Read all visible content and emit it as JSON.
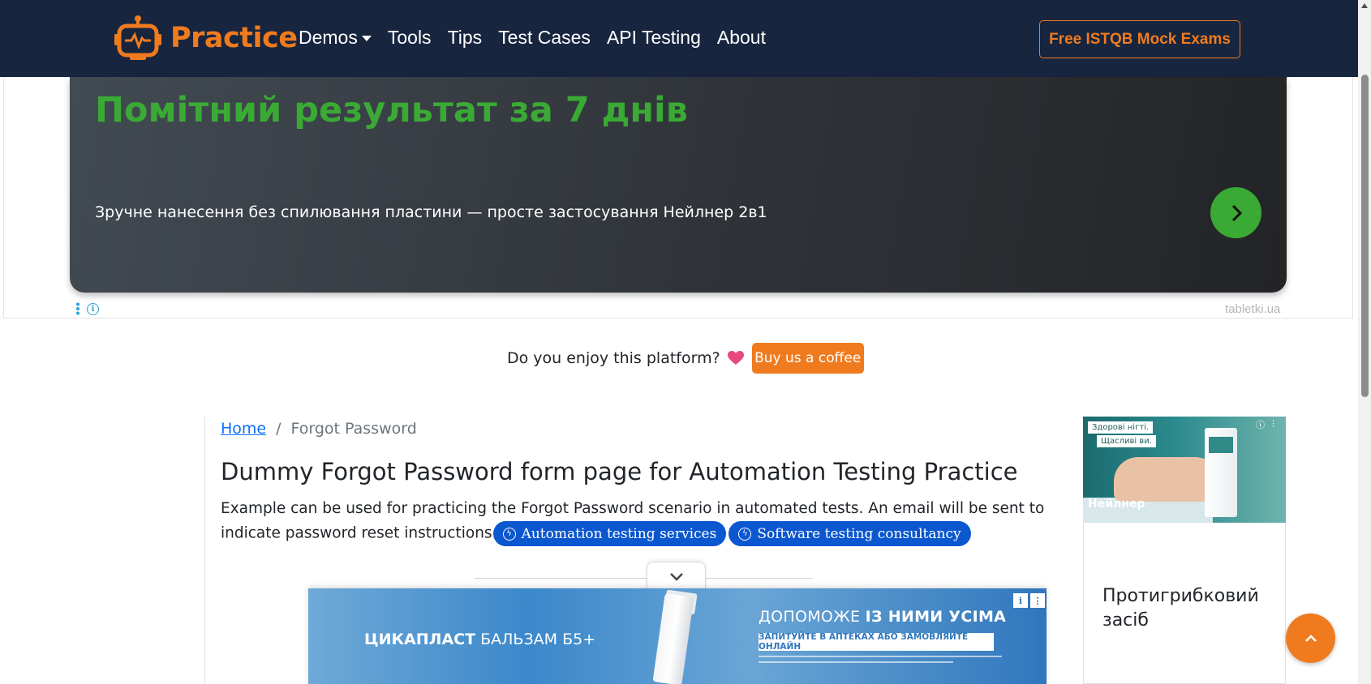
{
  "navbar": {
    "brand": "Practice",
    "links": [
      {
        "label": "Demos",
        "has_dropdown": true
      },
      {
        "label": "Tools"
      },
      {
        "label": "Tips"
      },
      {
        "label": "Test Cases"
      },
      {
        "label": "API Testing"
      },
      {
        "label": "About"
      }
    ],
    "cta": "Free ISTQB Mock Exams",
    "colors": {
      "bg": "#17253f",
      "accent": "#f07b1e"
    }
  },
  "top_ad": {
    "headline": "Помітний результат за 7 днів",
    "subtitle": "Зручне нанесення без спилювання пластини — просте застосування Нейлнер 2в1",
    "source": "tabletki.ua",
    "next_icon": "chevron-right-icon",
    "colors": {
      "headline": "#3aaa35"
    }
  },
  "coffee": {
    "question": "Do you enjoy this platform?",
    "heart_icon": "heart-icon",
    "button": "Buy us a coffee"
  },
  "breadcrumb": {
    "home": "Home",
    "separator": "/",
    "current": "Forgot Password"
  },
  "page": {
    "title": "Dummy Forgot Password form page for Automation Testing Practice",
    "description": "Example can be used for practicing the Forgot Password scenario in automated tests. An email will be sent to indicate password reset instructions",
    "pills": [
      "Automation testing services",
      "Software testing consultancy"
    ]
  },
  "bottom_ad": {
    "brand_bold": "ЦИКАПЛАСТ",
    "brand_rest": " БАЛЬЗАМ Б5+",
    "head_pre": "ДОПОМОЖЕ ",
    "head_bold": "ІЗ НИМИ УСІМА",
    "strip": "ЗАПИТУЙТЕ В АПТЕКАХ АБО ЗАМОВЛЯЙТЕ ОНЛАЙН"
  },
  "side_ad": {
    "tag1": "Здорові нігті.",
    "tag2": "Щасливі ви.",
    "brand": "Нейлнер",
    "text": "Протигрибковий засіб"
  }
}
